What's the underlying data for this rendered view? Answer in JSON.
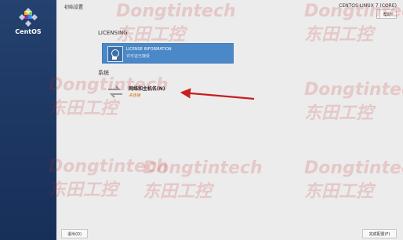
{
  "sidebar": {
    "logo_text": "CentOS"
  },
  "header": {
    "title": "初始设置",
    "product": "CENTOS LINUX 7 (CORE)",
    "help_label": "帮助!"
  },
  "licensing": {
    "heading": "LICENSING",
    "tile_title": "LICENSE INFORMATION",
    "tile_subtitle": "许可证已接受"
  },
  "system": {
    "heading": "系统",
    "network_title": "网络和主机名(N)",
    "network_subtitle": "未连接"
  },
  "footer": {
    "quit_label": "退出(Q)",
    "finish_label": "完成配置(F)"
  },
  "watermarks": {
    "en": "Dongtintech",
    "cn": "东田工控"
  },
  "colors": {
    "sidebar": "#1f3a66",
    "license_tile": "#4a88c8",
    "warning": "#d06a00",
    "annotation_arrow": "#c81e1e",
    "watermark": "#c82828"
  }
}
